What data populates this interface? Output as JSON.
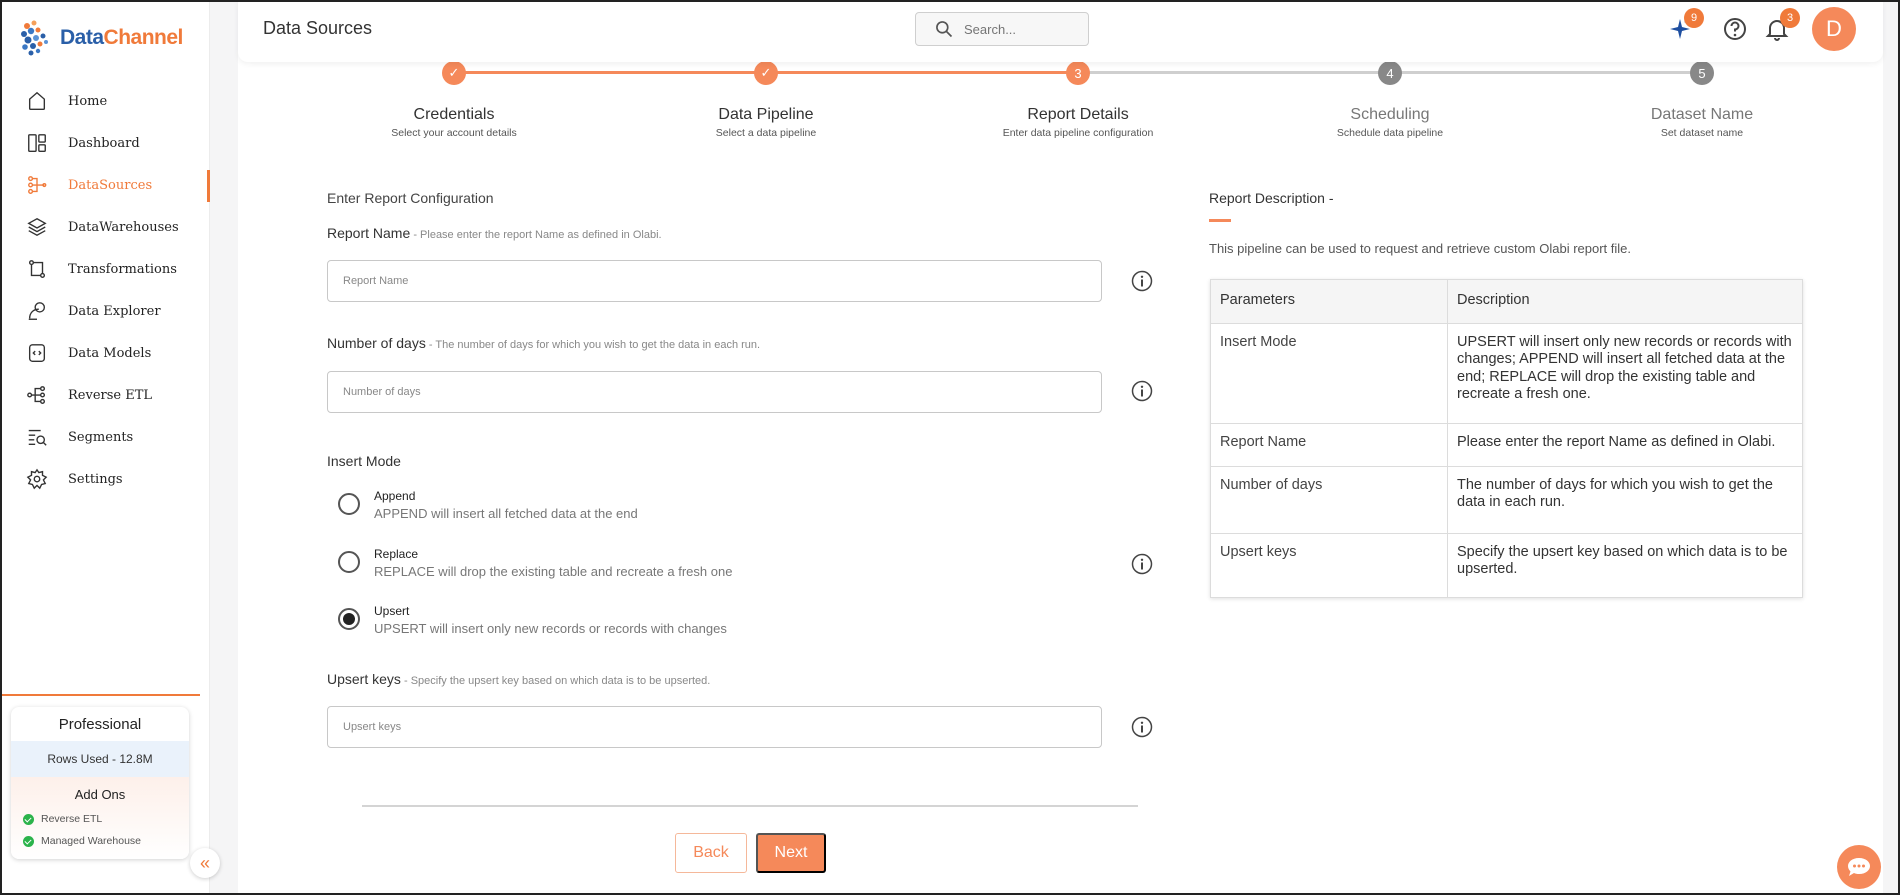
{
  "app": {
    "logo_text_a": "Data",
    "logo_text_b": "Channel",
    "accent_color": "#f5895a"
  },
  "sidebar": {
    "items": [
      {
        "label": "Home",
        "icon": "home-icon"
      },
      {
        "label": "Dashboard",
        "icon": "dashboard-icon"
      },
      {
        "label": "DataSources",
        "icon": "datasources-icon",
        "active": true
      },
      {
        "label": "DataWarehouses",
        "icon": "layers-icon"
      },
      {
        "label": "Transformations",
        "icon": "transform-icon"
      },
      {
        "label": "Data Explorer",
        "icon": "explorer-icon"
      },
      {
        "label": "Data Models",
        "icon": "data-models-icon"
      },
      {
        "label": "Reverse ETL",
        "icon": "reverse-etl-icon"
      },
      {
        "label": "Segments",
        "icon": "segments-icon"
      },
      {
        "label": "Settings",
        "icon": "gear-icon"
      }
    ],
    "plan": {
      "name": "Professional",
      "rows_used": "Rows Used - 12.8M",
      "addons_title": "Add Ons",
      "addons": [
        "Reverse ETL",
        "Managed Warehouse"
      ]
    }
  },
  "header": {
    "title": "Data Sources",
    "search_placeholder": "Search...",
    "sparkle_badge": "9",
    "notification_badge": "3",
    "avatar_initial": "D"
  },
  "stepper": {
    "steps": [
      {
        "label": "Credentials",
        "sub": "Select your account details",
        "status": "done",
        "number": "1"
      },
      {
        "label": "Data Pipeline",
        "sub": "Select a data pipeline",
        "status": "done",
        "number": "2"
      },
      {
        "label": "Report Details",
        "sub": "Enter data pipeline configuration",
        "status": "current",
        "number": "3"
      },
      {
        "label": "Scheduling",
        "sub": "Schedule data pipeline",
        "status": "todo",
        "number": "4"
      },
      {
        "label": "Dataset Name",
        "sub": "Set dataset name",
        "status": "todo",
        "number": "5"
      }
    ]
  },
  "form": {
    "section_title": "Enter Report Configuration",
    "report_name": {
      "label": "Report Name",
      "hint": " - Please enter the report Name as defined in Olabi.",
      "placeholder": "Report Name",
      "value": ""
    },
    "number_of_days": {
      "label": "Number of days",
      "hint": " - The number of days for which you wish to get the data in each run.",
      "placeholder": "Number of days",
      "value": ""
    },
    "insert_mode": {
      "label": "Insert Mode",
      "options": [
        {
          "title": "Append",
          "desc": "APPEND will insert all fetched data at the end",
          "checked": false
        },
        {
          "title": "Replace",
          "desc": "REPLACE will drop the existing table and recreate a fresh one",
          "checked": false
        },
        {
          "title": "Upsert",
          "desc": "UPSERT will insert only new records or records with changes",
          "checked": true
        }
      ]
    },
    "upsert_keys": {
      "label": "Upsert keys",
      "hint": " - Specify the upsert key based on which data is to be upserted.",
      "placeholder": "Upsert keys",
      "value": ""
    },
    "back_label": "Back",
    "next_label": "Next"
  },
  "description": {
    "title": "Report Description -",
    "text": "This pipeline can be used to request and retrieve custom Olabi report file.",
    "table": {
      "headers": [
        "Parameters",
        "Description"
      ],
      "rows": [
        [
          "Insert Mode",
          "UPSERT will insert only new records or records with changes; APPEND will insert all fetched data at the end; REPLACE will drop the existing table and recreate a fresh one."
        ],
        [
          "Report Name",
          "Please enter the report Name as defined in Olabi."
        ],
        [
          "Number of days",
          "The number of days for which you wish to get the data in each run."
        ],
        [
          "Upsert keys",
          "Specify the upsert key based on which data is to be upserted."
        ]
      ]
    }
  }
}
